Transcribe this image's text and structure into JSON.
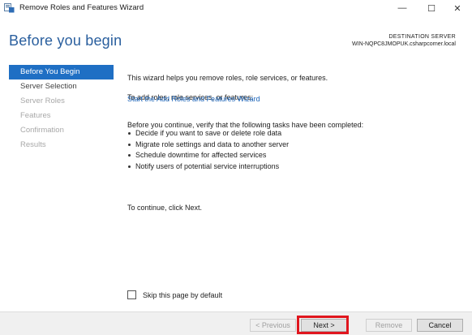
{
  "window": {
    "title": "Remove Roles and Features Wizard",
    "minimize_glyph": "—",
    "maximize_glyph": "☐",
    "close_glyph": "✕"
  },
  "header": {
    "page_title": "Before you begin",
    "destination_label": "DESTINATION SERVER",
    "destination_server": "WIN-NQPC8JMOPUK.csharpcorner.local"
  },
  "nav": {
    "items": [
      {
        "label": "Before You Begin",
        "state": "active"
      },
      {
        "label": "Server Selection",
        "state": "enabled"
      },
      {
        "label": "Server Roles",
        "state": "disabled"
      },
      {
        "label": "Features",
        "state": "disabled"
      },
      {
        "label": "Confirmation",
        "state": "disabled"
      },
      {
        "label": "Results",
        "state": "disabled"
      }
    ]
  },
  "content": {
    "intro": "This wizard helps you remove roles, role services, or features.",
    "add_prompt": "To add roles, role services, or features:",
    "add_link": "Start the Add Roles and Features Wizard",
    "before_continue": "Before you continue, verify that the following tasks have been completed:",
    "tasks": [
      "Decide if you want to save or delete role data",
      "Migrate role settings and data to another server",
      "Schedule downtime for affected services",
      "Notify users of potential service interruptions"
    ],
    "continue_text": "To continue, click Next.",
    "skip_label": "Skip this page by default"
  },
  "footer": {
    "previous_label": "< Previous",
    "next_label": "Next >",
    "remove_label": "Remove",
    "cancel_label": "Cancel"
  },
  "colors": {
    "accent": "#1f6fc4",
    "title_blue": "#2a5f9e",
    "link": "#1c64b8",
    "highlight": "#e0161e"
  },
  "icons": {
    "app": "server-manager-icon"
  }
}
